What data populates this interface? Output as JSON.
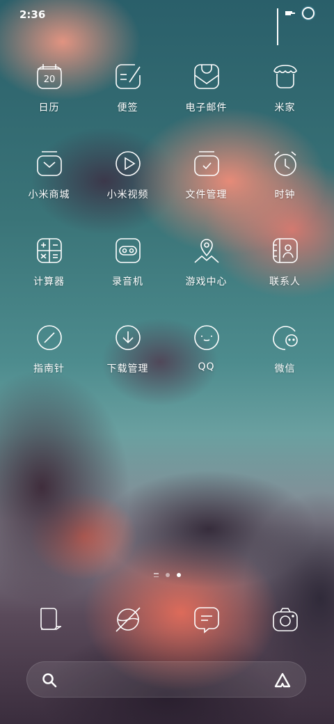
{
  "status_bar": {
    "time": "2:36",
    "icons": [
      "signal-icon",
      "network-speed-icon",
      "battery-ring-icon"
    ]
  },
  "apps": [
    {
      "label": "日历",
      "icon": "calendar-icon",
      "icon_text": "20"
    },
    {
      "label": "便签",
      "icon": "notes-icon"
    },
    {
      "label": "电子邮件",
      "icon": "email-icon"
    },
    {
      "label": "米家",
      "icon": "mijia-icon"
    },
    {
      "label": "小米商城",
      "icon": "shop-bag-icon"
    },
    {
      "label": "小米视频",
      "icon": "video-play-icon"
    },
    {
      "label": "文件管理",
      "icon": "file-manager-icon"
    },
    {
      "label": "时钟",
      "icon": "alarm-clock-icon"
    },
    {
      "label": "计算器",
      "icon": "calculator-icon"
    },
    {
      "label": "录音机",
      "icon": "recorder-icon"
    },
    {
      "label": "游戏中心",
      "icon": "game-center-icon"
    },
    {
      "label": "联系人",
      "icon": "contacts-icon"
    },
    {
      "label": "指南针",
      "icon": "compass-icon"
    },
    {
      "label": "下载管理",
      "icon": "download-icon"
    },
    {
      "label": "QQ",
      "icon": "qq-icon"
    },
    {
      "label": "微信",
      "icon": "wechat-icon"
    }
  ],
  "page_indicator": {
    "pages": 2,
    "current": 2
  },
  "dock": [
    {
      "icon": "phone-icon"
    },
    {
      "icon": "browser-icon"
    },
    {
      "icon": "messages-icon"
    },
    {
      "icon": "camera-icon"
    }
  ],
  "search_bar": {
    "left_icon": "search-icon",
    "right_icon": "assistant-icon"
  }
}
